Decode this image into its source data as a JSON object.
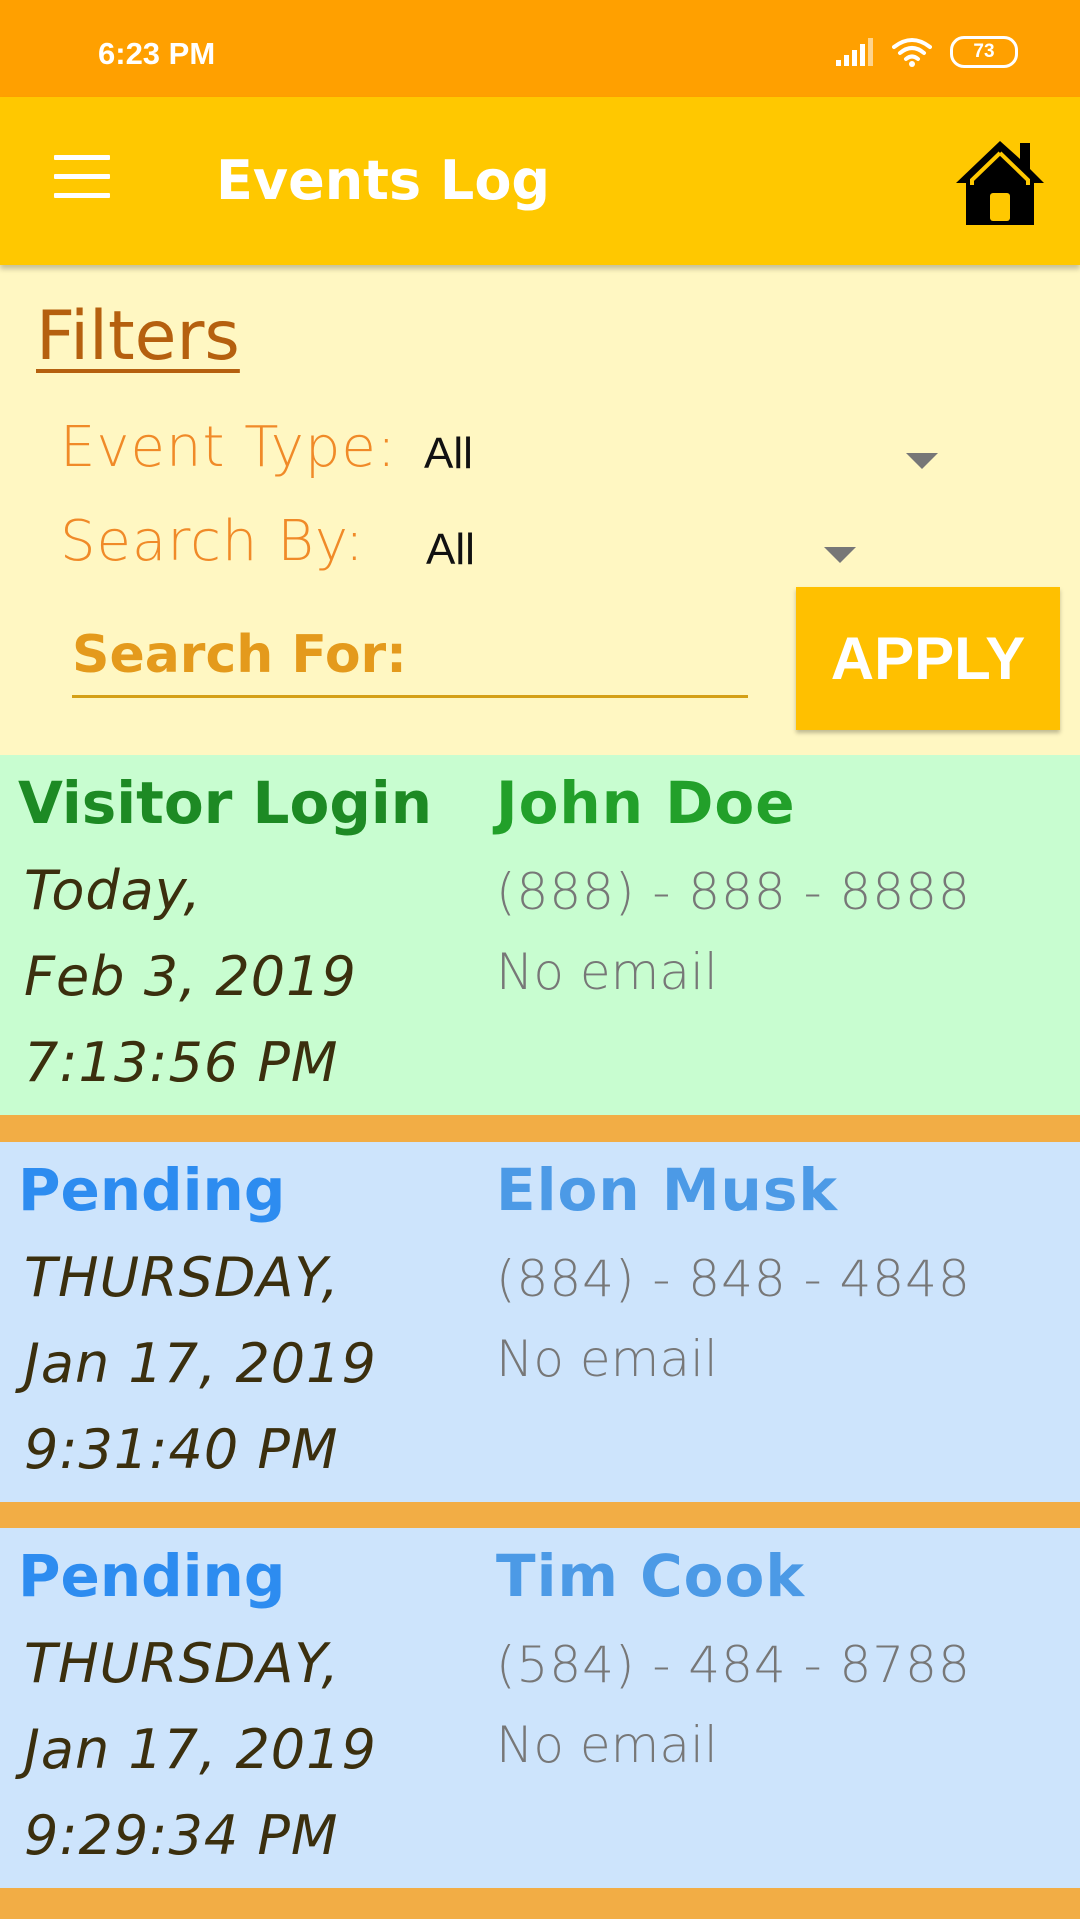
{
  "status_bar": {
    "time": "6:23 PM",
    "battery": "73"
  },
  "app_bar": {
    "title": "Events Log"
  },
  "filters": {
    "title": "Filters",
    "event_type_label": "Event Type:",
    "event_type_value": "All",
    "search_by_label": "Search By:",
    "search_by_value": "All",
    "search_for_placeholder": "Search For:",
    "apply_label": "APPLY"
  },
  "events": [
    {
      "type": "Visitor Login",
      "day": "Today,",
      "date": "Feb 3, 2019",
      "time": "7:13:56 PM",
      "name": "John Doe",
      "phone": "(888) - 888 - 8888",
      "email": "No email"
    },
    {
      "type": "Pending",
      "day": "THURSDAY,",
      "date": "Jan 17, 2019",
      "time": "9:31:40 PM",
      "name": "Elon Musk",
      "phone": "(884) - 848 - 4848",
      "email": "No email"
    },
    {
      "type": "Pending",
      "day": "THURSDAY,",
      "date": "Jan 17, 2019",
      "time": "9:29:34 PM",
      "name": "Tim Cook",
      "phone": "(584) - 484 - 8788",
      "email": "No email"
    }
  ],
  "colors": {
    "status_bar": "#ffa000",
    "app_bar": "#ffc800",
    "filter_bg": "#fff7c2",
    "visitor_login_bg": "#c8fdd0",
    "pending_bg": "#cde4fc",
    "separator": "#f2ad45"
  }
}
